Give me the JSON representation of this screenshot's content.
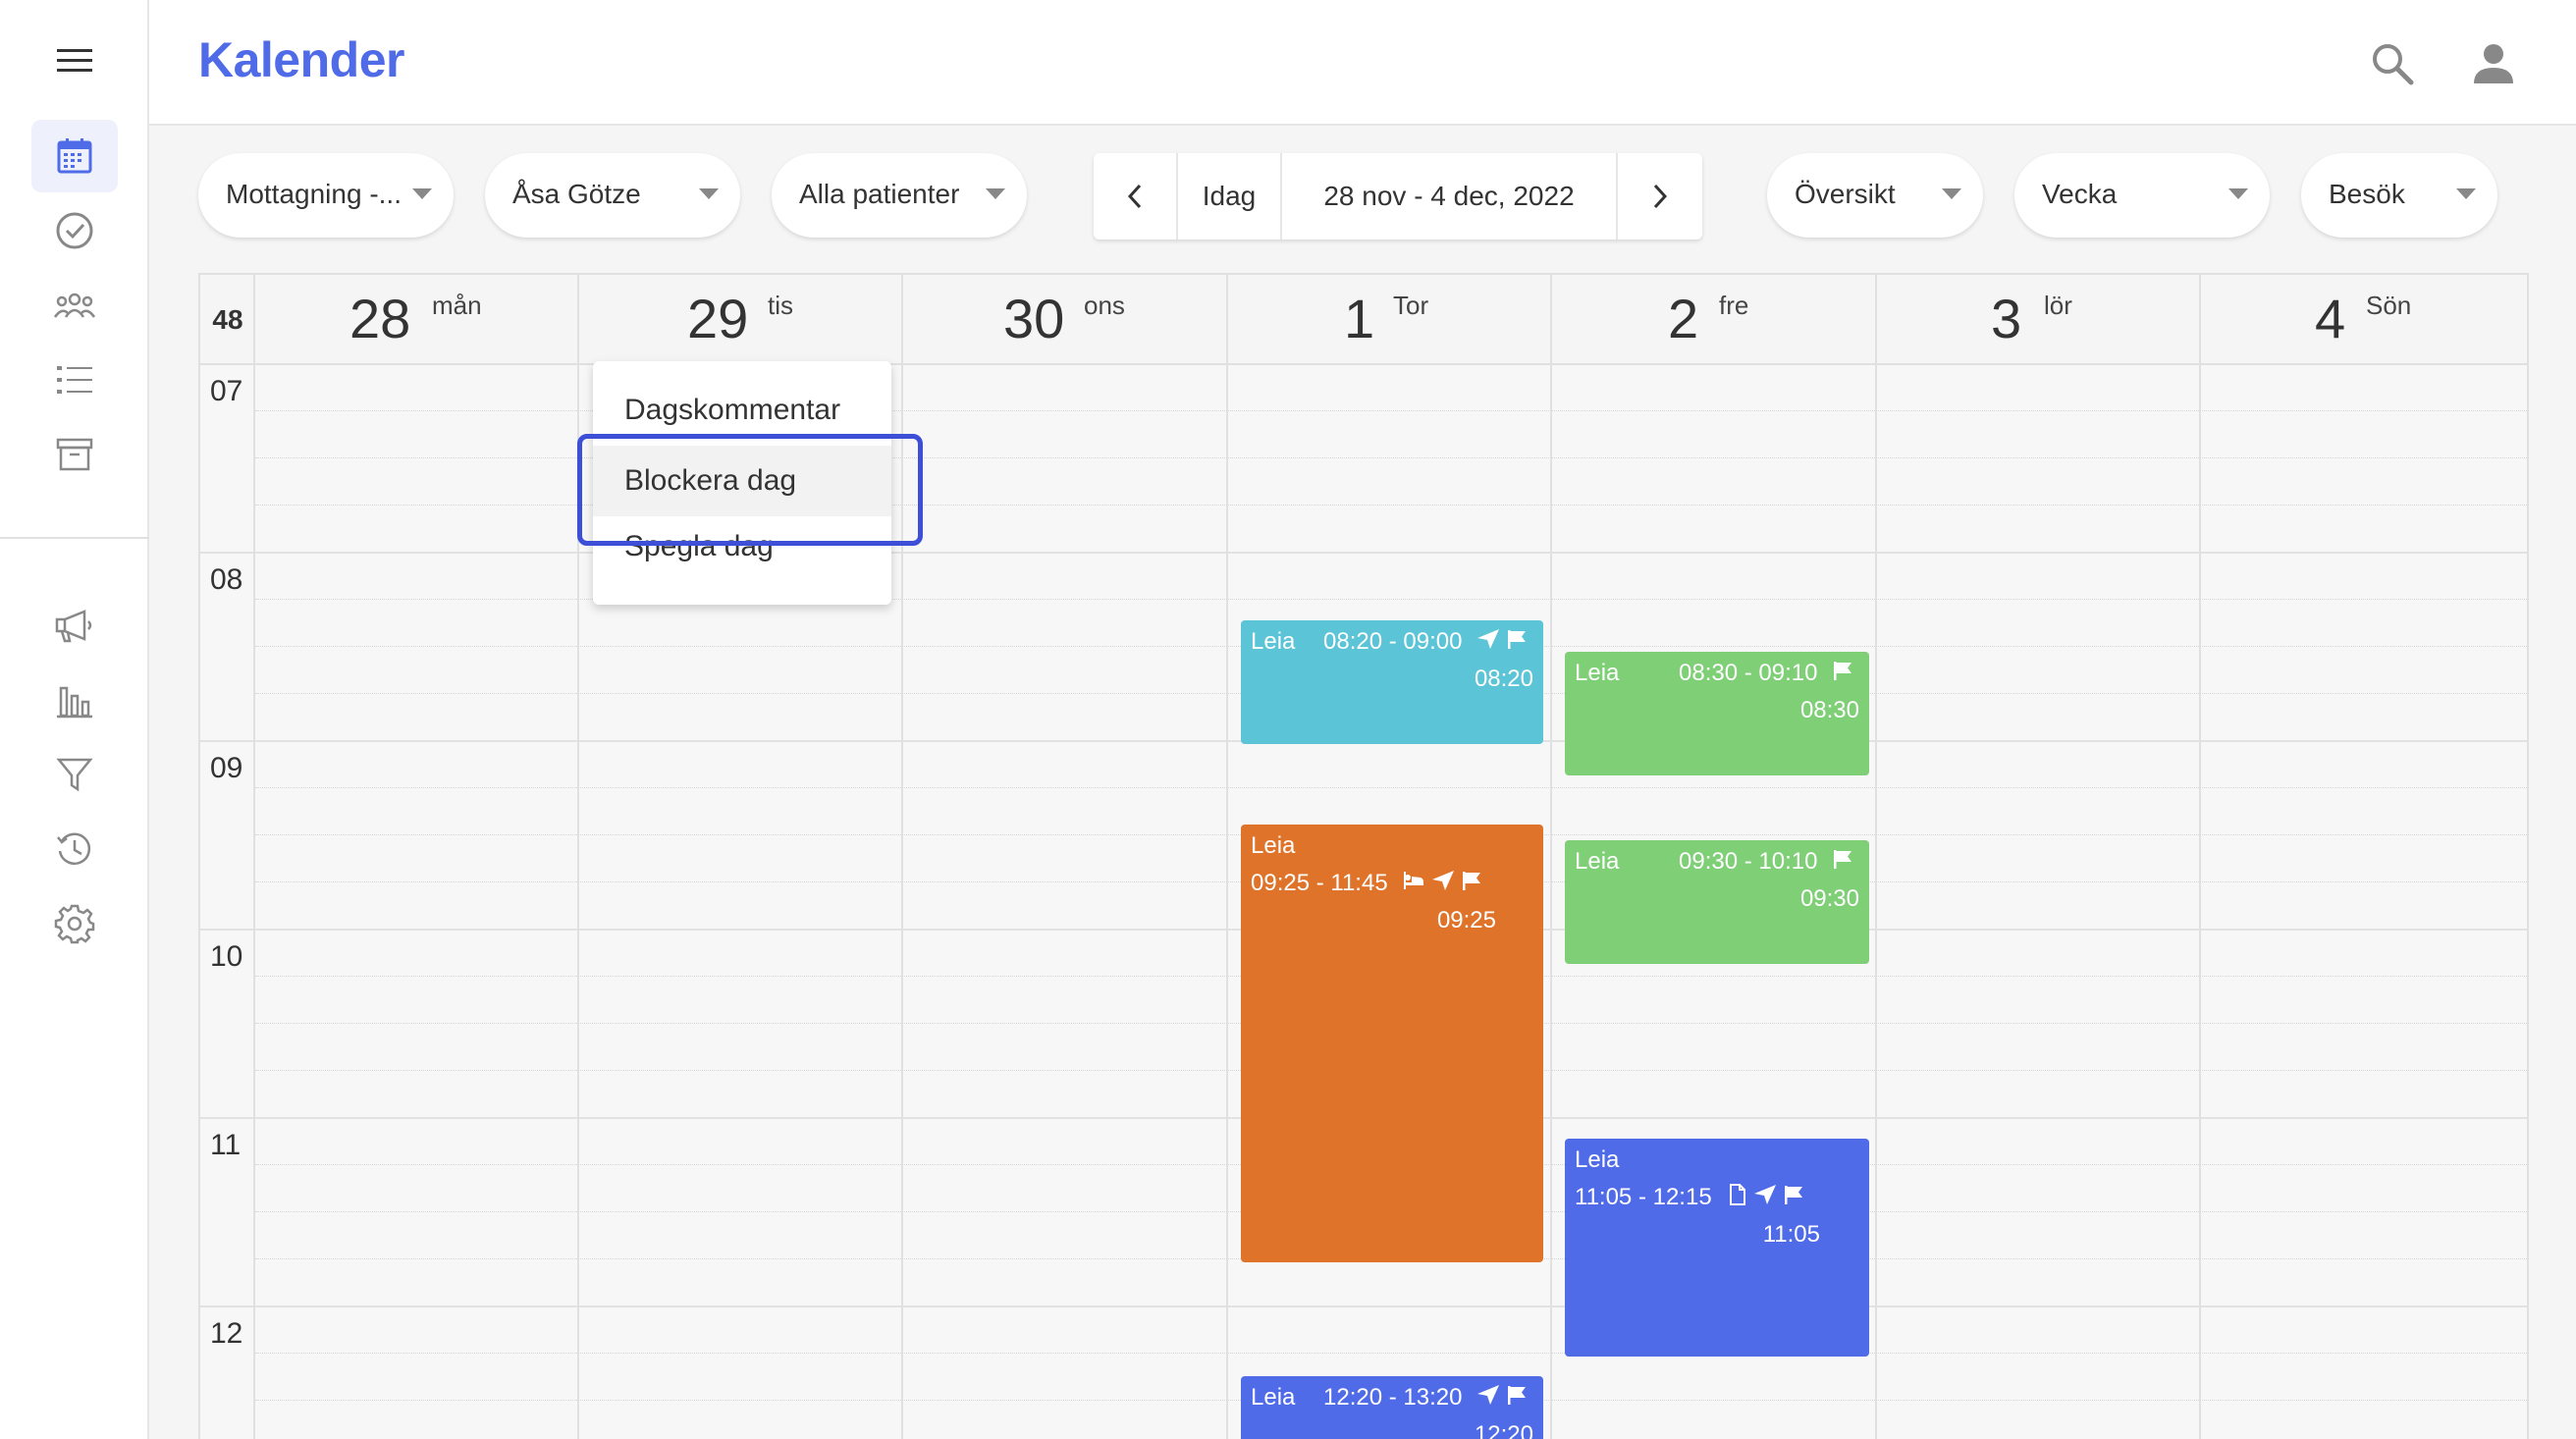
{
  "header": {
    "title": "Kalender"
  },
  "sidebar": {
    "items": [
      {
        "icon": "calendar-icon",
        "active": true
      },
      {
        "icon": "check-circle-icon"
      },
      {
        "icon": "group-icon"
      },
      {
        "icon": "list-icon"
      },
      {
        "icon": "archive-icon"
      },
      {
        "icon": "megaphone-icon"
      },
      {
        "icon": "bar-chart-icon"
      },
      {
        "icon": "filter-icon"
      },
      {
        "icon": "history-icon"
      },
      {
        "icon": "settings-icon"
      }
    ]
  },
  "toolbar": {
    "reception": "Mottagning -...",
    "staff": "Åsa Götze",
    "patients": "Alla patienter",
    "today": "Idag",
    "date_range": "28 nov - 4 dec, 2022",
    "view_mode": "Översikt",
    "period": "Vecka",
    "visit_type": "Besök"
  },
  "calendar": {
    "week_number": "48",
    "days": [
      {
        "num": "28",
        "name": "mån"
      },
      {
        "num": "29",
        "name": "tis"
      },
      {
        "num": "30",
        "name": "ons"
      },
      {
        "num": "1",
        "name": "Tor"
      },
      {
        "num": "2",
        "name": "fre"
      },
      {
        "num": "3",
        "name": "lör"
      },
      {
        "num": "4",
        "name": "Sön"
      }
    ],
    "hours": [
      "07",
      "08",
      "09",
      "10",
      "11",
      "12"
    ],
    "events": [
      {
        "name": "Leia",
        "time": "08:20 - 09:00",
        "start": "08:20",
        "color": "#5bc4d6"
      },
      {
        "name": "Leia",
        "time": "09:25 - 11:45",
        "start": "09:25",
        "color": "#e0732a"
      },
      {
        "name": "Leia",
        "time": "12:20 - 13:20",
        "start": "12:20",
        "color": "#4f6be8"
      },
      {
        "name": "Leia",
        "time": "08:30 - 09:10",
        "start": "08:30",
        "color": "#7ecf76"
      },
      {
        "name": "Leia",
        "time": "09:30 - 10:10",
        "start": "09:30",
        "color": "#7ecf76"
      },
      {
        "name": "Leia",
        "time": "11:05 - 12:15",
        "start": "11:05",
        "color": "#4f6be8"
      }
    ]
  },
  "day_menu": {
    "items": [
      "Dagskommentar",
      "Blockera dag",
      "Spegla dag"
    ]
  },
  "colors": {
    "accent": "#4f6be8",
    "highlight": "#3d4fd6"
  }
}
